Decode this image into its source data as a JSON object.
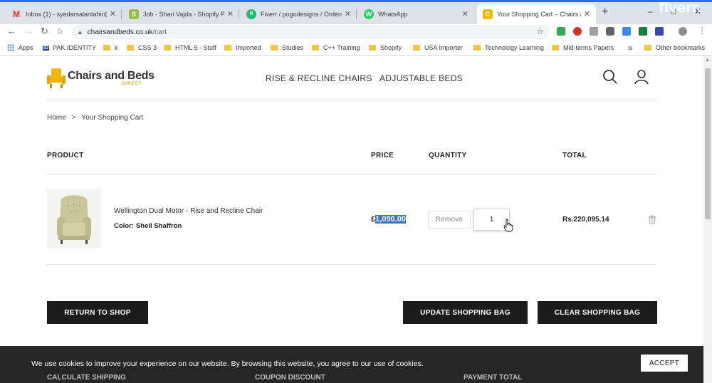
{
  "browser": {
    "tabs": [
      {
        "title": "Inbox (1) - syedarsalantahir@g",
        "icon": "gmail-icon",
        "color": "#d93025",
        "glyph": "M"
      },
      {
        "title": "Job - Shari Vajda - Shopify Par",
        "icon": "shopify-icon",
        "color": "#95bf47",
        "glyph": "S"
      },
      {
        "title": "Fiverr / pogodesigns / Orders",
        "icon": "fiverr-icon",
        "color": "#1dbf73",
        "glyph": "fi"
      },
      {
        "title": "WhatsApp",
        "icon": "whatsapp-icon",
        "color": "#25d366",
        "glyph": "W"
      },
      {
        "title": "Your Shopping Cart – Chairs a",
        "icon": "chair-favicon-icon",
        "color": "#f2b705",
        "glyph": "C"
      }
    ],
    "new_tab": "+",
    "window_controls": {
      "minimize": "–",
      "maximize": "□",
      "close": "✕"
    },
    "watermark": "fiverr.",
    "url_host": "chairsandbeds.co.uk",
    "url_path": "/cart",
    "bookmarks": [
      {
        "label": "Apps",
        "icon": "apps-grid-icon"
      },
      {
        "label": "PAK IDENTITY",
        "icon": "pak-identity-icon",
        "glyph": "ID"
      },
      {
        "label": "k",
        "icon": "folder-icon"
      },
      {
        "label": "CSS 3",
        "icon": "folder-icon"
      },
      {
        "label": "HTML 5 - Stuff",
        "icon": "folder-icon"
      },
      {
        "label": "Imported",
        "icon": "folder-icon"
      },
      {
        "label": "Studies",
        "icon": "folder-icon"
      },
      {
        "label": "C++ Training",
        "icon": "folder-icon"
      },
      {
        "label": "Shopify",
        "icon": "folder-icon"
      },
      {
        "label": "USA Importer",
        "icon": "folder-icon"
      },
      {
        "label": "Technology Learning",
        "icon": "folder-icon"
      },
      {
        "label": "Mid-terms Papers",
        "icon": "folder-icon"
      }
    ],
    "bookmarks_more": "»",
    "other_bookmarks": "Other bookmarks"
  },
  "site": {
    "logo_main": "Chairs and Beds",
    "logo_sub": "DIRECT",
    "nav": [
      "RISE & RECLINE CHAIRS",
      "ADJUSTABLE BEDS"
    ],
    "breadcrumb": {
      "home": "Home",
      "separator": ">",
      "current": "Your Shopping Cart"
    }
  },
  "cart": {
    "headers": {
      "product": "PRODUCT",
      "price": "PRICE",
      "quantity": "QUANTITY",
      "total": "TOTAL"
    },
    "item": {
      "name": "Wellington Dual Motor - Rise and Recline Chair",
      "color_label": "Color:",
      "color_value": "Shell Shaffron",
      "price_currency": "£",
      "price_value": "1,090.00",
      "remove_label": "Remove",
      "quantity": "1",
      "total": "Rs.220,095.14"
    },
    "buttons": {
      "return": "RETURN TO SHOP",
      "update": "UPDATE SHOPPING BAG",
      "clear": "CLEAR SHOPPING BAG"
    },
    "sections_behind_cookie": [
      "CALCULATE SHIPPING",
      "COUPON DISCOUNT",
      "PAYMENT TOTAL"
    ]
  },
  "cookie": {
    "text": "We use cookies to improve your experience on our website. By browsing this website, you agree to our use of cookies.",
    "accept": "ACCEPT"
  },
  "colors": {
    "brand_yellow": "#f2b705",
    "dark_button": "#1c1c1c",
    "selection_blue": "#3a72d8",
    "chrome_blue": "#1a73e8"
  }
}
